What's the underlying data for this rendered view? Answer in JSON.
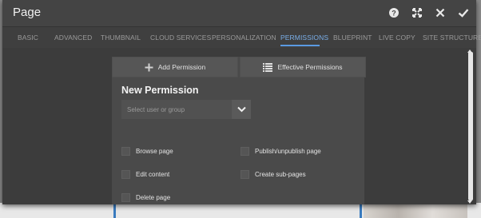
{
  "dialog": {
    "title": "Page"
  },
  "titlebar_icons": [
    "help-icon",
    "fullscreen-icon",
    "close-icon",
    "done-icon"
  ],
  "tabs": [
    {
      "label": "BASIC"
    },
    {
      "label": "ADVANCED"
    },
    {
      "label": "THUMBNAIL"
    },
    {
      "label": "CLOUD SERVICES"
    },
    {
      "label": "PERSONALIZATION"
    },
    {
      "label": "PERMISSIONS",
      "active": true
    },
    {
      "label": "BLUEPRINT"
    },
    {
      "label": "LIVE COPY"
    },
    {
      "label": "SITE STRUCTURE"
    }
  ],
  "buttons": {
    "add_permission": "Add Permission",
    "effective_permissions": "Effective Permissions"
  },
  "new_permission": {
    "title": "New Permission",
    "select_placeholder": "Select user or group",
    "checkboxes": {
      "browse_page": "Browse page",
      "publish": "Publish/unpublish page",
      "edit_content": "Edit content",
      "create_subpages": "Create sub-pages",
      "delete_page": "Delete page"
    }
  },
  "colors": {
    "accent": "#5a9ae2",
    "dialog_bg": "#3c3c3c",
    "panel_bg": "#4a4a4a"
  }
}
